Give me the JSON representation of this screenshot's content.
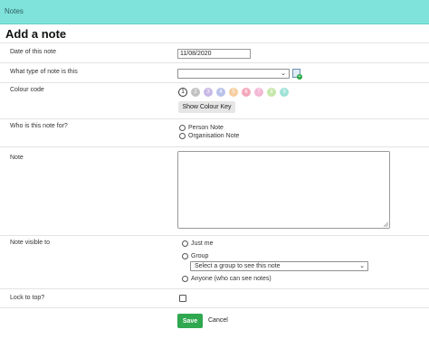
{
  "window": {
    "title": "Notes"
  },
  "page": {
    "heading": "Add a note"
  },
  "fields": {
    "date": {
      "label": "Date of this note",
      "value": "11/08/2020"
    },
    "note_type": {
      "label": "What type of note is this",
      "value": ""
    },
    "colour": {
      "label": "Colour code",
      "swatches": [
        {
          "number": "1",
          "color": "#ffffff",
          "selected": true
        },
        {
          "number": "2",
          "color": "#c2c2c2"
        },
        {
          "number": "3",
          "color": "#c8b8e6"
        },
        {
          "number": "4",
          "color": "#b9c2ea"
        },
        {
          "number": "5",
          "color": "#f6ce9e"
        },
        {
          "number": "6",
          "color": "#f4a8bc"
        },
        {
          "number": "7",
          "color": "#f3b8d6"
        },
        {
          "number": "8",
          "color": "#c5e7a9"
        },
        {
          "number": "9",
          "color": "#9fe2d8"
        }
      ],
      "key_button": "Show Colour Key"
    },
    "who_for": {
      "label": "Who is this note for?",
      "options": [
        "Person Note",
        "Organisation Note"
      ]
    },
    "note": {
      "label": "Note",
      "value": ""
    },
    "visibility": {
      "label": "Note visible to",
      "options": [
        "Just me",
        "Group",
        "Anyone (who can see notes)"
      ],
      "group_select": "Select a group to see this note"
    },
    "lock": {
      "label": "Lock to top?",
      "checked": false
    }
  },
  "actions": {
    "save": "Save",
    "cancel": "Cancel"
  },
  "colors": {
    "header": "#7fe3dc",
    "save": "#2fa84f"
  }
}
